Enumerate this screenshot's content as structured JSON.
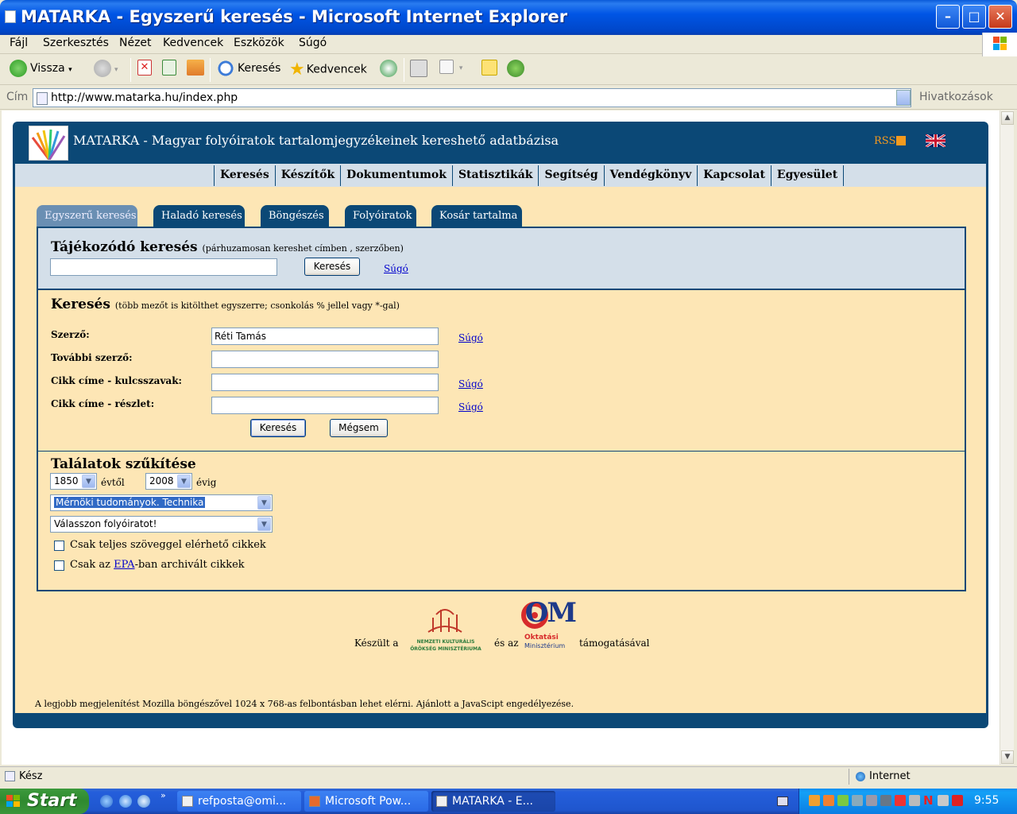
{
  "window": {
    "title": "MATARKA - Egyszerű keresés - Microsoft Internet Explorer"
  },
  "menu": [
    "Fájl",
    "Szerkesztés",
    "Nézet",
    "Kedvencek",
    "Eszközök",
    "Súgó"
  ],
  "toolbar": {
    "back": "Vissza",
    "search": "Keresés",
    "favorites": "Kedvencek"
  },
  "address": {
    "label": "Cím",
    "url": "http://www.matarka.hu/index.php",
    "links": "Hivatkozások"
  },
  "site": {
    "title": "MATARKA - Magyar folyóiratok tartalomjegyzékeinek kereshető adatbázisa",
    "rss": "RSS",
    "nav": [
      "Keresés",
      "Készítők",
      "Dokumentumok",
      "Statisztikák",
      "Segítség",
      "Vendégkönyv",
      "Kapcsolat",
      "Egyesület"
    ],
    "tabs": [
      "Egyszerű keresés",
      "Haladó keresés",
      "Böngészés",
      "Folyóiratok",
      "Kosár tartalma"
    ]
  },
  "quick": {
    "title": "Tájékozódó keresés",
    "hint": "(párhuzamosan kereshet címben , szerzőben)",
    "value": "",
    "button": "Keresés",
    "help": "Súgó"
  },
  "search": {
    "title": "Keresés",
    "hint": "(több mezőt is kitölthet egyszerre; csonkolás % jellel vagy *-gal)",
    "author_label": "Szerző:",
    "author_value": "Réti Tamás",
    "more_authors_label": "További szerző:",
    "more_authors_value": "",
    "keywords_label": "Cikk címe - kulcsszavak:",
    "keywords_value": "",
    "part_label": "Cikk címe - részlet:",
    "part_value": "",
    "help": "Súgó",
    "submit": "Keresés",
    "cancel": "Mégsem"
  },
  "narrow": {
    "title": "Találatok szűkítése",
    "from_year": "1850",
    "from_label": "évtől",
    "to_year": "2008",
    "to_label": "évig",
    "subject": "Mérnöki tudományok. Technika",
    "journal": "Válasszon folyóiratot!",
    "fulltext_label": "Csak teljes szöveggel elérhető cikkek",
    "epa_pre": "Csak az ",
    "epa_link": "EPA",
    "epa_post": "-ban archivált cikkek"
  },
  "footer": {
    "made": "Készült a",
    "and": "és az",
    "support": "támogatásával",
    "sponsor1": "NEMZETI KULTURÁLIS ÖRÖKSÉG MINISZTÉRIUMA",
    "sponsor2_top": "Oktatási",
    "sponsor2_bottom": "Minisztérium",
    "om": "OM",
    "note": "A legjobb megjelenítést Mozilla böngészővel 1024 x 768-as felbontásban lehet elérni. Ajánlott a JavaScipt engedélyezése."
  },
  "status": {
    "left": "Kész",
    "zone": "Internet"
  },
  "taskbar": {
    "start": "Start",
    "tasks": [
      "refposta@omi...",
      "Microsoft Pow...",
      "MATARKA - E..."
    ],
    "clock": "9:55"
  }
}
